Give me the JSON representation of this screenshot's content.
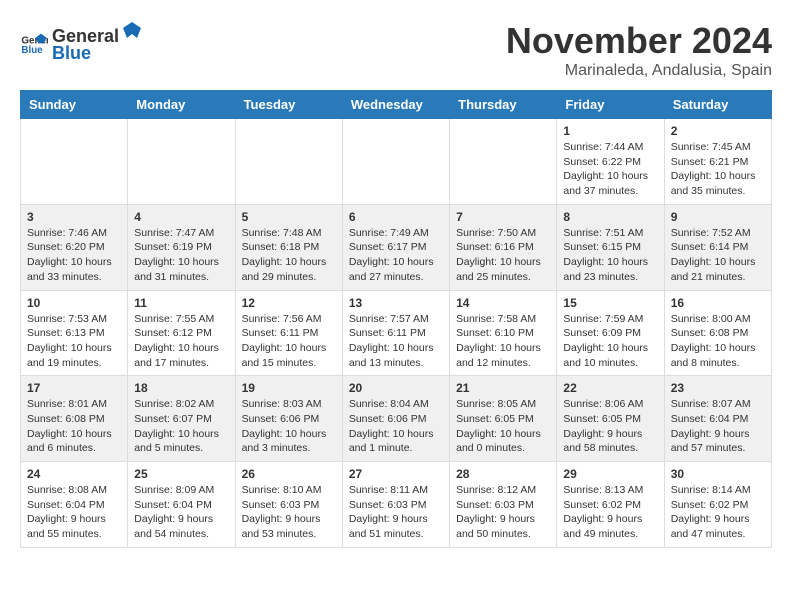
{
  "header": {
    "logo_general": "General",
    "logo_blue": "Blue",
    "month_title": "November 2024",
    "location": "Marinaleda, Andalusia, Spain"
  },
  "days_of_week": [
    "Sunday",
    "Monday",
    "Tuesday",
    "Wednesday",
    "Thursday",
    "Friday",
    "Saturday"
  ],
  "weeks": [
    {
      "days": [
        {
          "num": "",
          "data": ""
        },
        {
          "num": "",
          "data": ""
        },
        {
          "num": "",
          "data": ""
        },
        {
          "num": "",
          "data": ""
        },
        {
          "num": "",
          "data": ""
        },
        {
          "num": "1",
          "data": "Sunrise: 7:44 AM\nSunset: 6:22 PM\nDaylight: 10 hours and 37 minutes."
        },
        {
          "num": "2",
          "data": "Sunrise: 7:45 AM\nSunset: 6:21 PM\nDaylight: 10 hours and 35 minutes."
        }
      ]
    },
    {
      "days": [
        {
          "num": "3",
          "data": "Sunrise: 7:46 AM\nSunset: 6:20 PM\nDaylight: 10 hours and 33 minutes."
        },
        {
          "num": "4",
          "data": "Sunrise: 7:47 AM\nSunset: 6:19 PM\nDaylight: 10 hours and 31 minutes."
        },
        {
          "num": "5",
          "data": "Sunrise: 7:48 AM\nSunset: 6:18 PM\nDaylight: 10 hours and 29 minutes."
        },
        {
          "num": "6",
          "data": "Sunrise: 7:49 AM\nSunset: 6:17 PM\nDaylight: 10 hours and 27 minutes."
        },
        {
          "num": "7",
          "data": "Sunrise: 7:50 AM\nSunset: 6:16 PM\nDaylight: 10 hours and 25 minutes."
        },
        {
          "num": "8",
          "data": "Sunrise: 7:51 AM\nSunset: 6:15 PM\nDaylight: 10 hours and 23 minutes."
        },
        {
          "num": "9",
          "data": "Sunrise: 7:52 AM\nSunset: 6:14 PM\nDaylight: 10 hours and 21 minutes."
        }
      ]
    },
    {
      "days": [
        {
          "num": "10",
          "data": "Sunrise: 7:53 AM\nSunset: 6:13 PM\nDaylight: 10 hours and 19 minutes."
        },
        {
          "num": "11",
          "data": "Sunrise: 7:55 AM\nSunset: 6:12 PM\nDaylight: 10 hours and 17 minutes."
        },
        {
          "num": "12",
          "data": "Sunrise: 7:56 AM\nSunset: 6:11 PM\nDaylight: 10 hours and 15 minutes."
        },
        {
          "num": "13",
          "data": "Sunrise: 7:57 AM\nSunset: 6:11 PM\nDaylight: 10 hours and 13 minutes."
        },
        {
          "num": "14",
          "data": "Sunrise: 7:58 AM\nSunset: 6:10 PM\nDaylight: 10 hours and 12 minutes."
        },
        {
          "num": "15",
          "data": "Sunrise: 7:59 AM\nSunset: 6:09 PM\nDaylight: 10 hours and 10 minutes."
        },
        {
          "num": "16",
          "data": "Sunrise: 8:00 AM\nSunset: 6:08 PM\nDaylight: 10 hours and 8 minutes."
        }
      ]
    },
    {
      "days": [
        {
          "num": "17",
          "data": "Sunrise: 8:01 AM\nSunset: 6:08 PM\nDaylight: 10 hours and 6 minutes."
        },
        {
          "num": "18",
          "data": "Sunrise: 8:02 AM\nSunset: 6:07 PM\nDaylight: 10 hours and 5 minutes."
        },
        {
          "num": "19",
          "data": "Sunrise: 8:03 AM\nSunset: 6:06 PM\nDaylight: 10 hours and 3 minutes."
        },
        {
          "num": "20",
          "data": "Sunrise: 8:04 AM\nSunset: 6:06 PM\nDaylight: 10 hours and 1 minute."
        },
        {
          "num": "21",
          "data": "Sunrise: 8:05 AM\nSunset: 6:05 PM\nDaylight: 10 hours and 0 minutes."
        },
        {
          "num": "22",
          "data": "Sunrise: 8:06 AM\nSunset: 6:05 PM\nDaylight: 9 hours and 58 minutes."
        },
        {
          "num": "23",
          "data": "Sunrise: 8:07 AM\nSunset: 6:04 PM\nDaylight: 9 hours and 57 minutes."
        }
      ]
    },
    {
      "days": [
        {
          "num": "24",
          "data": "Sunrise: 8:08 AM\nSunset: 6:04 PM\nDaylight: 9 hours and 55 minutes."
        },
        {
          "num": "25",
          "data": "Sunrise: 8:09 AM\nSunset: 6:04 PM\nDaylight: 9 hours and 54 minutes."
        },
        {
          "num": "26",
          "data": "Sunrise: 8:10 AM\nSunset: 6:03 PM\nDaylight: 9 hours and 53 minutes."
        },
        {
          "num": "27",
          "data": "Sunrise: 8:11 AM\nSunset: 6:03 PM\nDaylight: 9 hours and 51 minutes."
        },
        {
          "num": "28",
          "data": "Sunrise: 8:12 AM\nSunset: 6:03 PM\nDaylight: 9 hours and 50 minutes."
        },
        {
          "num": "29",
          "data": "Sunrise: 8:13 AM\nSunset: 6:02 PM\nDaylight: 9 hours and 49 minutes."
        },
        {
          "num": "30",
          "data": "Sunrise: 8:14 AM\nSunset: 6:02 PM\nDaylight: 9 hours and 47 minutes."
        }
      ]
    }
  ]
}
